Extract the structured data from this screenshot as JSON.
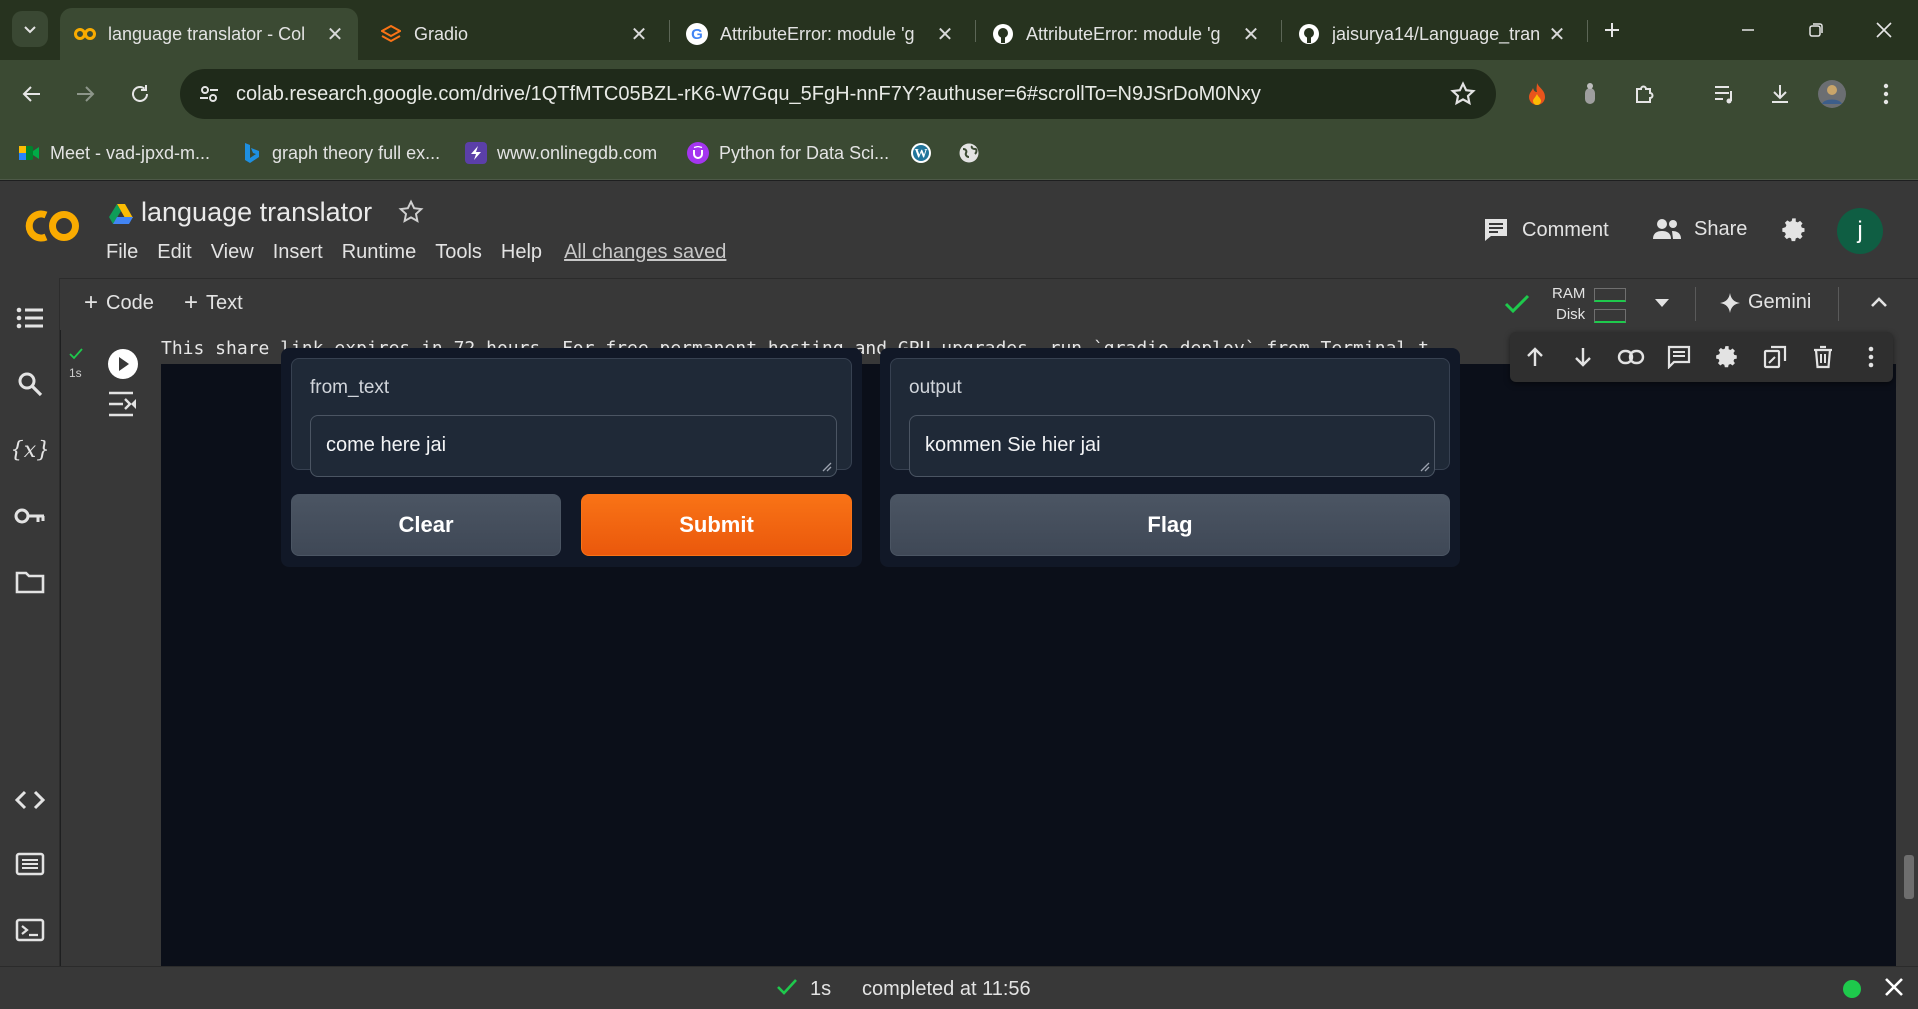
{
  "browser": {
    "tabs": [
      {
        "title": "language translator - Col",
        "icon": "colab-icon",
        "active": true
      },
      {
        "title": "Gradio",
        "icon": "gradio-icon",
        "active": false
      },
      {
        "title": "AttributeError: module 'g",
        "icon": "google-icon",
        "active": false
      },
      {
        "title": "AttributeError: module 'g",
        "icon": "github-icon",
        "active": false
      },
      {
        "title": "jaisurya14/Language_tran",
        "icon": "github-icon",
        "active": false
      }
    ],
    "url": "colab.research.google.com/drive/1QTfMTC05BZL-rK6-W7Gqu_5FgH-nnF7Y?authuser=6#scrollTo=N9JSrDoM0Nxy",
    "bookmarks": [
      {
        "label": "Meet - vad-jpxd-m...",
        "icon": "meet-icon"
      },
      {
        "label": "graph theory full ex...",
        "icon": "bing-icon"
      },
      {
        "label": "www.onlinegdb.com",
        "icon": "onlinegdb-icon"
      },
      {
        "label": "Python for Data Sci...",
        "icon": "udemy-icon"
      },
      {
        "label": "",
        "icon": "wordpress-icon"
      },
      {
        "label": "",
        "icon": "globe-icon"
      }
    ]
  },
  "colab": {
    "title": "language translator",
    "menu": [
      "File",
      "Edit",
      "View",
      "Insert",
      "Runtime",
      "Tools",
      "Help"
    ],
    "saved_status": "All changes saved",
    "comment_label": "Comment",
    "share_label": "Share",
    "avatar_letter": "j",
    "add_code_label": "Code",
    "add_text_label": "Text",
    "ram_label": "RAM",
    "disk_label": "Disk",
    "gemini_label": "Gemini"
  },
  "cell": {
    "exec_time": "1s",
    "output_text": "This share link expires in 72 hours. For free permanent hosting and GPU upgrades, run `gradio deploy` from Terminal t"
  },
  "gradio": {
    "input_label": "from_text",
    "input_value": "come here jai",
    "output_label": "output",
    "output_value": "kommen Sie hier jai",
    "clear_label": "Clear",
    "submit_label": "Submit",
    "flag_label": "Flag",
    "colors": {
      "primary": "#f97316",
      "background": "#0b0f19",
      "panel": "#111827"
    }
  },
  "status": {
    "time": "1s",
    "text": "completed at 11:56",
    "indicator_color": "#1ec94c"
  }
}
